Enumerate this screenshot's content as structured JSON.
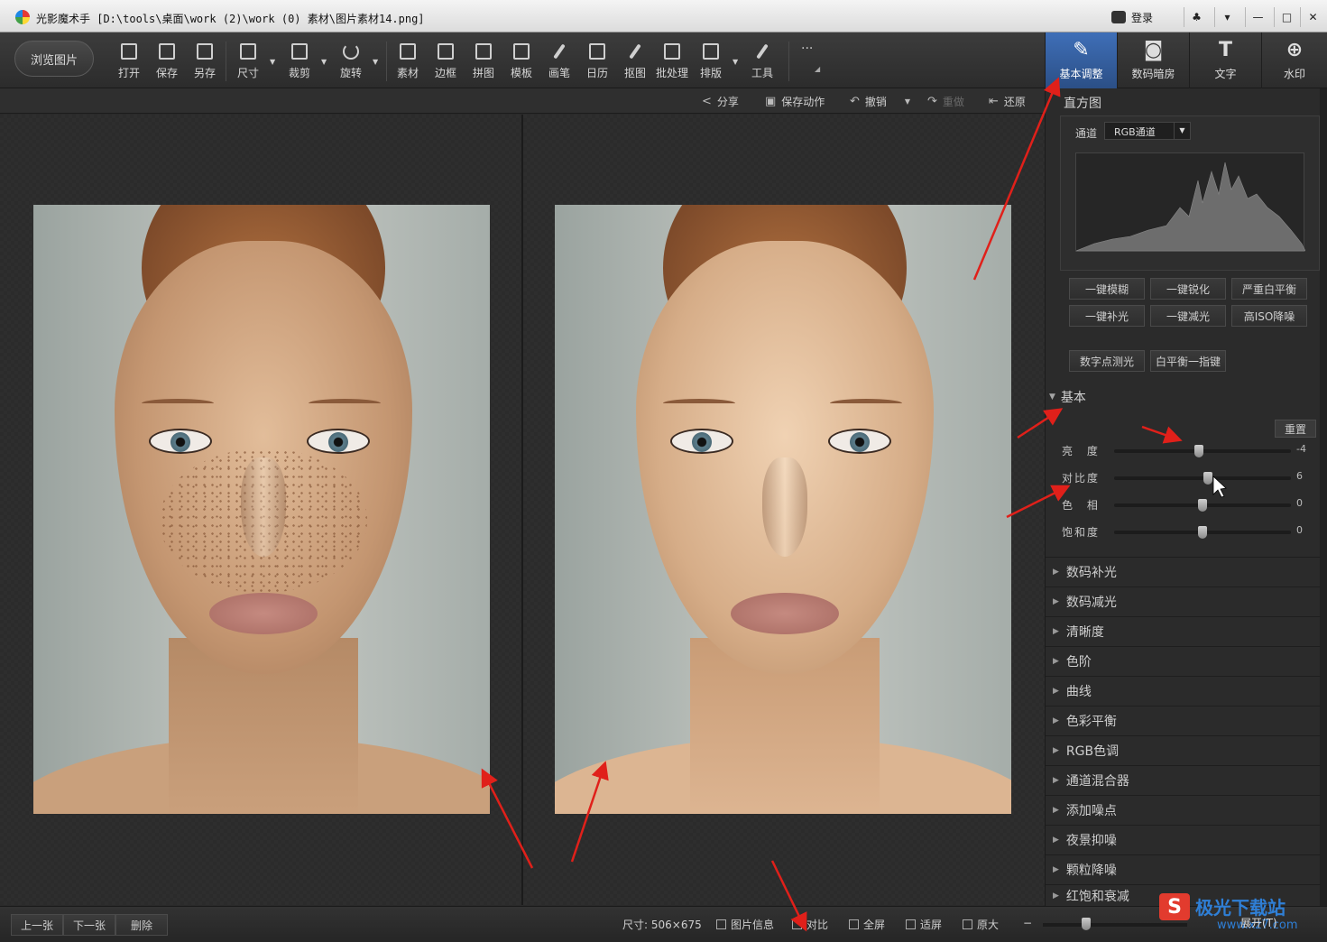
{
  "titlebar": {
    "title": "光影魔术手 [D:\\tools\\桌面\\work (2)\\work (0) 素材\\图片素材14.png]",
    "login": "登录",
    "btn_min": "—",
    "btn_max": "□",
    "btn_close": "✕"
  },
  "toolbar": {
    "browse": "浏览图片",
    "tools": [
      "打开",
      "保存",
      "另存",
      "尺寸",
      "裁剪",
      "旋转",
      "素材",
      "边框",
      "拼图",
      "模板",
      "画笔",
      "日历",
      "抠图",
      "批处理",
      "排版",
      "工具"
    ],
    "more": "···"
  },
  "right_tabs": [
    "基本调整",
    "数码暗房",
    "文字",
    "水印"
  ],
  "subbar": {
    "share": "分享",
    "save_action": "保存动作",
    "undo": "撤销",
    "redo": "重做",
    "restore": "还原"
  },
  "panel": {
    "histogram_title": "直方图",
    "channel_label": "通道",
    "channel_value": "RGB通道",
    "quick_buttons_row1": [
      "一键模糊",
      "一键锐化",
      "严重白平衡"
    ],
    "quick_buttons_row2": [
      "一键补光",
      "一键减光",
      "高ISO降噪"
    ],
    "quick_buttons_row3": [
      "数字点测光",
      "白平衡一指键"
    ],
    "basic_title": "基本",
    "reset": "重置",
    "sliders": [
      {
        "label": "亮 度",
        "value": "-4",
        "pos": 0.48
      },
      {
        "label": "对比度",
        "value": "6",
        "pos": 0.53
      },
      {
        "label": "色 相",
        "value": "0",
        "pos": 0.5
      },
      {
        "label": "饱和度",
        "value": "0",
        "pos": 0.5
      }
    ],
    "sections": [
      "数码补光",
      "数码减光",
      "清晰度",
      "色阶",
      "曲线",
      "色彩平衡",
      "RGB色调",
      "通道混合器",
      "添加噪点",
      "夜景抑噪",
      "颗粒降噪",
      "红饱和衰减"
    ]
  },
  "statusbar": {
    "prev": "上一张",
    "next": "下一张",
    "delete": "删除",
    "size": "尺寸: 506×675",
    "info": "图片信息",
    "compare": "对比",
    "fullscreen": "全屏",
    "fit": "适屏",
    "original": "原大",
    "zoom_minus": "−",
    "zoom_level": 0.3
  },
  "watermark": {
    "logo": "S",
    "text": "极光下载站",
    "url": "www.xz7.com",
    "sub": "展开(T)"
  },
  "colors": {
    "accent": "#3f6fb8",
    "arrow": "#e0201a"
  }
}
